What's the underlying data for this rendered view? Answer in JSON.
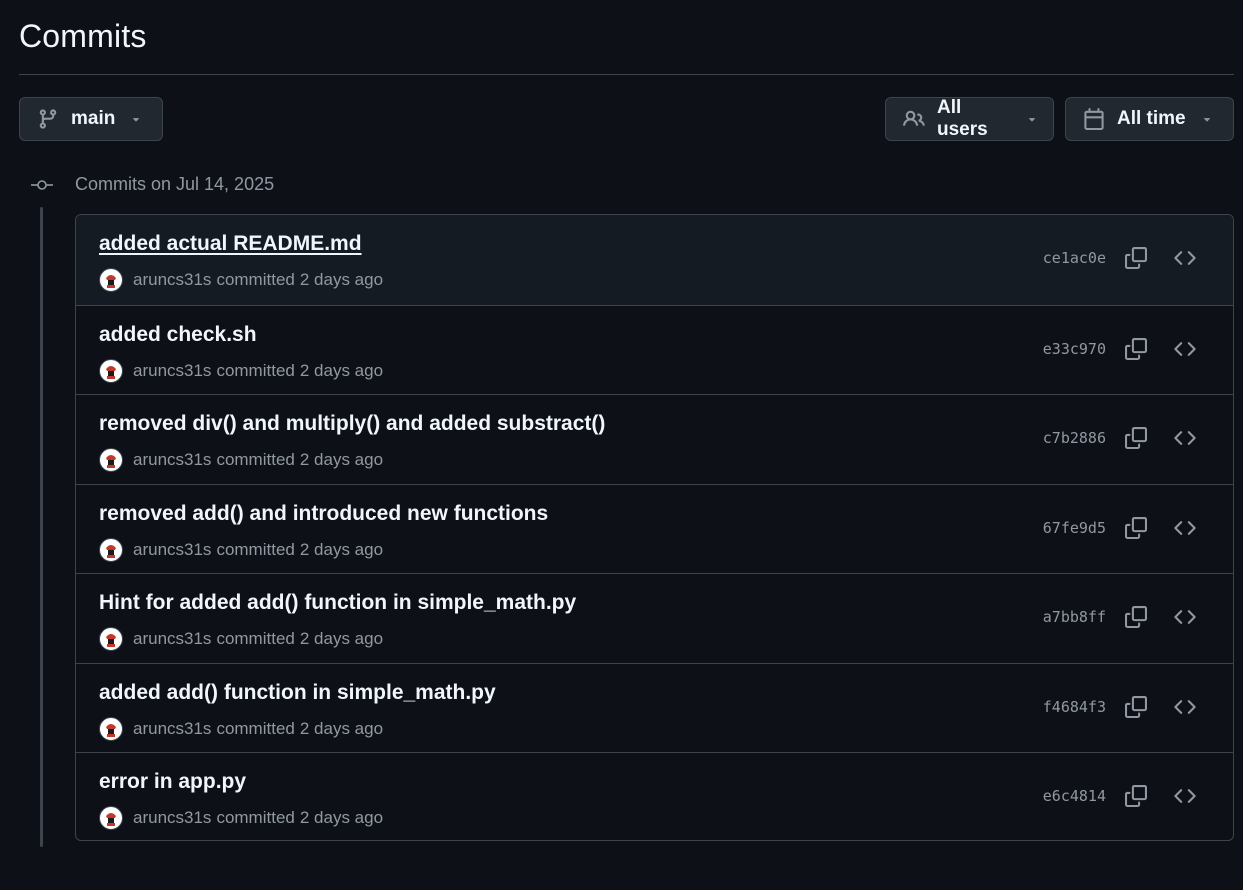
{
  "page": {
    "title": "Commits"
  },
  "filters": {
    "branch_label": "main",
    "users_label": "All users",
    "time_label": "All time"
  },
  "group": {
    "label": "Commits on Jul 14, 2025"
  },
  "commits": [
    {
      "message": "added actual README.md",
      "author": "aruncs31s",
      "verb": "committed",
      "time": "2 days ago",
      "sha": "ce1ac0e"
    },
    {
      "message": "added check.sh",
      "author": "aruncs31s",
      "verb": "committed",
      "time": "2 days ago",
      "sha": "e33c970"
    },
    {
      "message": "removed div() and multiply() and added substract()",
      "author": "aruncs31s",
      "verb": "committed",
      "time": "2 days ago",
      "sha": "c7b2886"
    },
    {
      "message": "removed add() and introduced new functions",
      "author": "aruncs31s",
      "verb": "committed",
      "time": "2 days ago",
      "sha": "67fe9d5"
    },
    {
      "message": "Hint for added add() function in simple_math.py",
      "author": "aruncs31s",
      "verb": "committed",
      "time": "2 days ago",
      "sha": "a7bb8ff"
    },
    {
      "message": "added add() function in simple_math.py",
      "author": "aruncs31s",
      "verb": "committed",
      "time": "2 days ago",
      "sha": "f4684f3"
    },
    {
      "message": "error in app.py",
      "author": "aruncs31s",
      "verb": "committed",
      "time": "2 days ago",
      "sha": "e6c4814"
    }
  ],
  "icons": {
    "branch": "git-branch-icon",
    "users": "people-icon",
    "time": "calendar-icon",
    "caret": "triangle-down-icon",
    "node": "git-commit-icon",
    "copy": "copy-icon",
    "browse": "code-icon",
    "avatar": "avatar"
  },
  "colors": {
    "background": "#0d1117",
    "surface": "#212830",
    "row_hover": "#151b23",
    "border": "#3d444d",
    "text": "#f0f6fc",
    "muted": "#9198a1",
    "avatar_accent": "#c0392b"
  }
}
